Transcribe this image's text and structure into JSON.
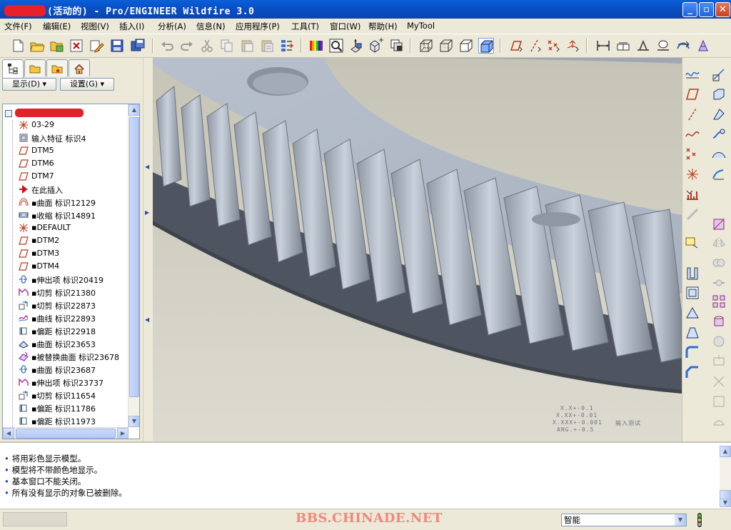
{
  "window": {
    "title_suffix": "(活动的) - Pro/ENGINEER Wildfire 3.0",
    "minimize_label": "_",
    "maximize_label": "▫",
    "close_label": "✕"
  },
  "menu": [
    {
      "label": "文件(F)"
    },
    {
      "label": "编辑(E)"
    },
    {
      "label": "视图(V)"
    },
    {
      "label": "插入(I)"
    },
    {
      "label": "分析(A)"
    },
    {
      "label": "信息(N)"
    },
    {
      "label": "应用程序(P)"
    },
    {
      "label": "工具(T)"
    },
    {
      "label": "窗口(W)"
    },
    {
      "label": "帮助(H)"
    },
    {
      "label": "MyTool"
    }
  ],
  "toolbar_icons": [
    "new-icon",
    "open-icon",
    "open-session-icon",
    "close-window-icon",
    "edit-icon",
    "save-icon",
    "save-copy-icon",
    "undo-icon",
    "redo-icon",
    "cut-icon",
    "copy-icon",
    "paste-icon",
    "paste-special-icon",
    "regenerate-icon",
    "color-appearance-icon",
    "zoom-window-icon",
    "reorient-icon",
    "saved-views-icon",
    "layers-icon",
    "wireframe-icon",
    "hidden-line-icon",
    "no-hidden-icon",
    "shading-icon",
    "datum-plane-display-icon",
    "datum-axis-display-icon",
    "datum-point-display-icon",
    "csys-display-icon",
    "dimension-icon",
    "gdt-icon",
    "surface-finish-icon",
    "note-icon",
    "spin-center-icon",
    "annotation-icon"
  ],
  "panel": {
    "tabs": [
      "model-tree-tab",
      "folder-browser-tab",
      "favorites-tab",
      "connections-tab"
    ],
    "show_button": "显示(D) ▾",
    "settings_button": "设置(G) ▾"
  },
  "tree": [
    {
      "label": "03-29",
      "icon": "csys-icon"
    },
    {
      "label": "输入特征 标识4",
      "icon": "import-feature-icon"
    },
    {
      "label": "DTM5",
      "icon": "datum-plane-icon"
    },
    {
      "label": "DTM6",
      "icon": "datum-plane-icon"
    },
    {
      "label": "DTM7",
      "icon": "datum-plane-icon"
    },
    {
      "label": "在此插入",
      "icon": "insert-here-arrow-icon"
    },
    {
      "label": "▪曲面 标识12129",
      "icon": "surface-icon"
    },
    {
      "label": "▪收缩 标识14891",
      "icon": "shrink-icon"
    },
    {
      "label": "▪DEFAULT",
      "icon": "csys-icon"
    },
    {
      "label": "▪DTM2",
      "icon": "datum-plane-icon"
    },
    {
      "label": "▪DTM3",
      "icon": "datum-plane-icon"
    },
    {
      "label": "▪DTM4",
      "icon": "datum-plane-icon"
    },
    {
      "label": "▪伸出项 标识20419",
      "icon": "revolve-icon"
    },
    {
      "label": "▪切剪 标识21380",
      "icon": "extrude-cut-icon"
    },
    {
      "label": "▪切剪 标识22873",
      "icon": "cut-icon"
    },
    {
      "label": "▪曲线 标识22893",
      "icon": "curve-icon"
    },
    {
      "label": "▪偏距 标识22918",
      "icon": "offset-icon"
    },
    {
      "label": "▪曲面 标识23653",
      "icon": "surface-merge-icon"
    },
    {
      "label": "▪被替换曲面 标识23678",
      "icon": "replace-surface-icon"
    },
    {
      "label": "▪曲面 标识23687",
      "icon": "revolve-icon"
    },
    {
      "label": "▪伸出项 标识23737",
      "icon": "extrude-icon"
    },
    {
      "label": "▪切剪 标识11654",
      "icon": "cut-icon"
    },
    {
      "label": "▪偏距 标识11786",
      "icon": "offset-icon"
    },
    {
      "label": "▪偏距 标识11973",
      "icon": "offset-icon"
    }
  ],
  "tolerance": [
    "X.X+-0.1",
    "X.XX+-0.01",
    "X.XXX+-0.001",
    "ANG.+-0.5",
    "输入测试"
  ],
  "messages": [
    "将用彩色显示模型。",
    "模型将不带颜色地显示。",
    "基本窗口不能关闭。",
    "所有没有显示的对象已被删除。"
  ],
  "status": {
    "watermark": "BBS.CHINADE.NET",
    "filter_value": "智能"
  },
  "colors": {
    "gear_top": "#b3bbc7",
    "gear_dark": "#4f5560",
    "background": "#d6d3c6",
    "title_bar": "#0a5fd8"
  }
}
